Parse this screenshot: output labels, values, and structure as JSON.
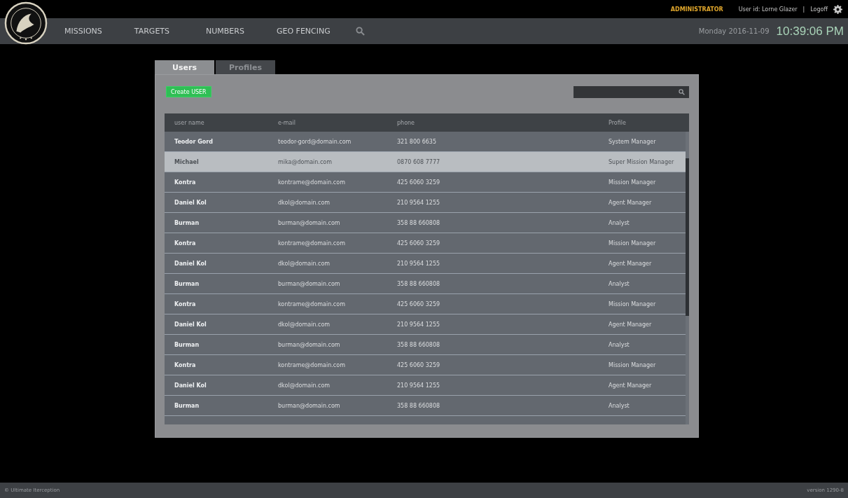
{
  "top_bar": {
    "role": "ADMINISTRATOR",
    "user": "User id: Lorne Glazer",
    "separator": "|",
    "logoff": "Logoff"
  },
  "nav": {
    "items": [
      "MISSIONS",
      "TARGETS",
      "NUMBERS",
      "GEO FENCING"
    ],
    "date": "Monday 2016-11-09",
    "time": "10:39:06 PM"
  },
  "tabs": [
    {
      "label": "Users",
      "selected": true
    },
    {
      "label": "Profiles",
      "selected": false
    }
  ],
  "create_button": "Create USER",
  "table": {
    "columns": [
      "user name",
      "e-mail",
      "phone",
      "Profile"
    ],
    "rows": [
      {
        "cells": [
          "Teodor Gord",
          "teodor-gord@domain.com",
          "321 800 6635",
          "System Manager"
        ],
        "selected": false
      },
      {
        "cells": [
          "Michael",
          "mika@domain.com",
          "0870 608 7777",
          "Super Mission Manager"
        ],
        "selected": true
      },
      {
        "cells": [
          "Kontra",
          "kontrame@domain.com",
          "425 6060 3259",
          "Mission Manager"
        ],
        "selected": false
      },
      {
        "cells": [
          "Daniel Kol",
          "dkol@domain.com",
          "210 9564 1255",
          "Agent Manager"
        ],
        "selected": false
      },
      {
        "cells": [
          "Burman",
          "burman@domain.com",
          "358 88 660808",
          "Analyst"
        ],
        "selected": false
      },
      {
        "cells": [
          "Kontra",
          "kontrame@domain.com",
          "425 6060 3259",
          "Mission Manager"
        ],
        "selected": false
      },
      {
        "cells": [
          "Daniel Kol",
          "dkol@domain.com",
          "210 9564 1255",
          "Agent Manager"
        ],
        "selected": false
      },
      {
        "cells": [
          "Burman",
          "burman@domain.com",
          "358 88 660808",
          "Analyst"
        ],
        "selected": false
      },
      {
        "cells": [
          "Kontra",
          "kontrame@domain.com",
          "425 6060 3259",
          "Mission Manager"
        ],
        "selected": false
      },
      {
        "cells": [
          "Daniel Kol",
          "dkol@domain.com",
          "210 9564 1255",
          "Agent Manager"
        ],
        "selected": false
      },
      {
        "cells": [
          "Burman",
          "burman@domain.com",
          "358 88 660808",
          "Analyst"
        ],
        "selected": false
      },
      {
        "cells": [
          "Kontra",
          "kontrame@domain.com",
          "425 6060 3259",
          "Mission Manager"
        ],
        "selected": false
      },
      {
        "cells": [
          "Daniel Kol",
          "dkol@domain.com",
          "210 9564 1255",
          "Agent Manager"
        ],
        "selected": false
      },
      {
        "cells": [
          "Burman",
          "burman@domain.com",
          "358 88 660808",
          "Analyst"
        ],
        "selected": false
      }
    ]
  },
  "footer": {
    "copyright": "© Ultimate Iterception",
    "version": "version 1290-8"
  }
}
